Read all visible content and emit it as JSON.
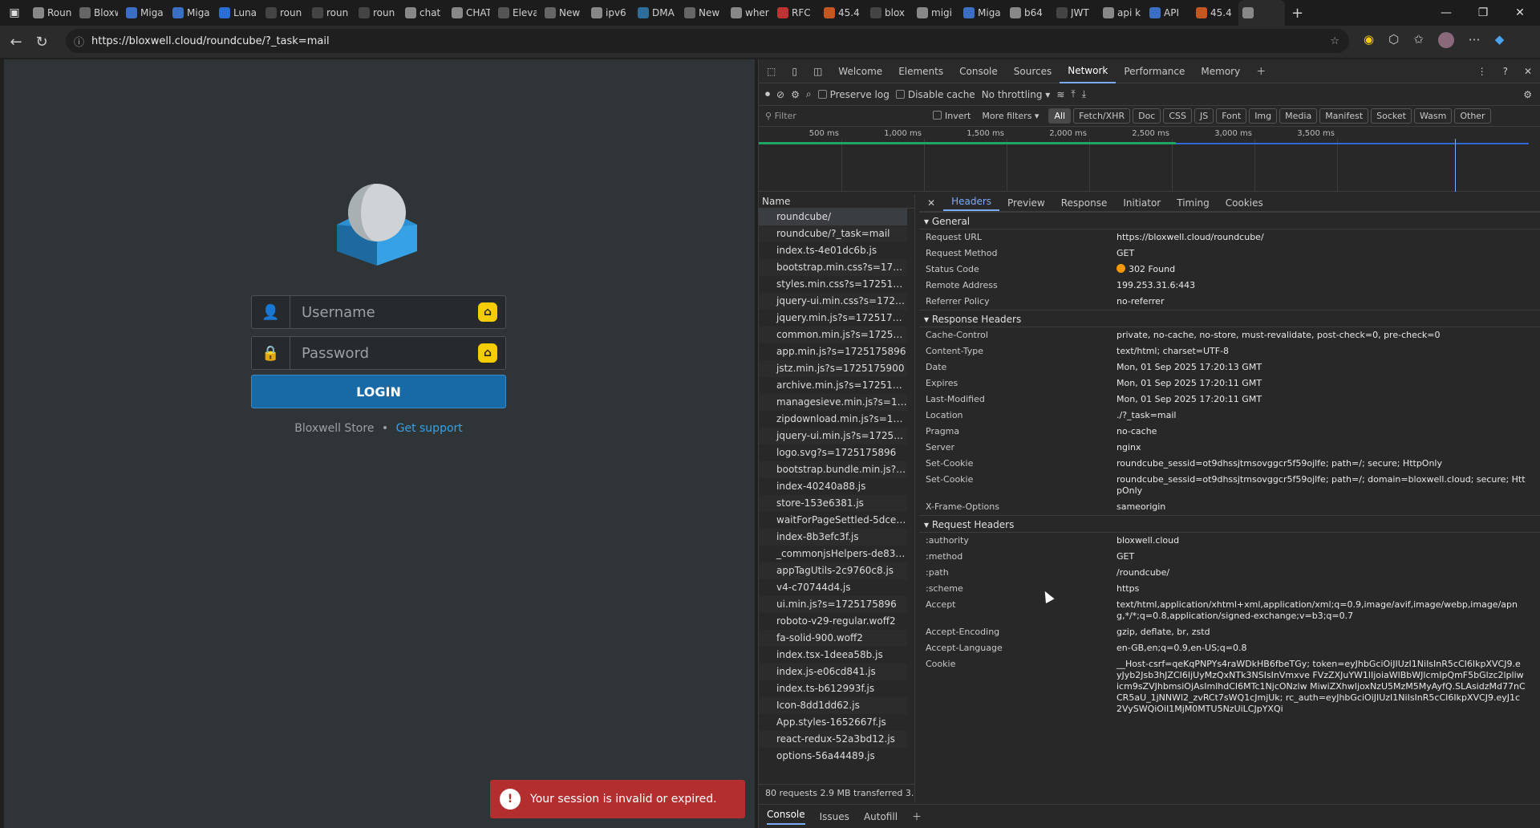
{
  "browser": {
    "tabs": [
      {
        "label": "Roun",
        "color": "#888888"
      },
      {
        "label": "Bloxw",
        "color": "#666666"
      },
      {
        "label": "Miga",
        "color": "#3b6fc4"
      },
      {
        "label": "Miga",
        "color": "#3b6fc4"
      },
      {
        "label": "Luna",
        "color": "#2a6fd6"
      },
      {
        "label": "roun",
        "color": "#444444"
      },
      {
        "label": "roun",
        "color": "#444444"
      },
      {
        "label": "roun",
        "color": "#444444"
      },
      {
        "label": "chat",
        "color": "#888888"
      },
      {
        "label": "CHAT",
        "color": "#888888"
      },
      {
        "label": "Eleva",
        "color": "#555555"
      },
      {
        "label": "New",
        "color": "#666666"
      },
      {
        "label": "ipv6",
        "color": "#888888"
      },
      {
        "label": "DMA",
        "color": "#2c6e99"
      },
      {
        "label": "New",
        "color": "#666666"
      },
      {
        "label": "wher",
        "color": "#888888"
      },
      {
        "label": "RFC",
        "color": "#b33"
      },
      {
        "label": "45.4",
        "color": "#c4561f"
      },
      {
        "label": "blox",
        "color": "#444444"
      },
      {
        "label": "migi",
        "color": "#888888"
      },
      {
        "label": "Miga",
        "color": "#3b6fc4"
      },
      {
        "label": "b64",
        "color": "#888888"
      },
      {
        "label": "JWT",
        "color": "#444444"
      },
      {
        "label": "api k",
        "color": "#888888"
      },
      {
        "label": "API",
        "color": "#3b6fc4"
      },
      {
        "label": "45.4",
        "color": "#c4561f"
      },
      {
        "label": "",
        "color": "#888888"
      }
    ],
    "url": "https://bloxwell.cloud/roundcube/?_task=mail"
  },
  "page": {
    "username_placeholder": "Username",
    "password_placeholder": "Password",
    "login_label": "LOGIN",
    "footer_store": "Bloxwell Store",
    "footer_sep": "•",
    "footer_support": "Get support",
    "toast": "Your session is invalid or expired."
  },
  "devtools": {
    "tabs": [
      "Welcome",
      "Elements",
      "Console",
      "Sources",
      "Network",
      "Performance",
      "Memory"
    ],
    "toolbar": {
      "preserve": "Preserve log",
      "disable": "Disable cache",
      "throttle": "No throttling"
    },
    "filter": {
      "placeholder": "Filter",
      "invert": "Invert",
      "more": "More filters",
      "chips": [
        "All",
        "Fetch/XHR",
        "Doc",
        "CSS",
        "JS",
        "Font",
        "Img",
        "Media",
        "Manifest",
        "Socket",
        "Wasm",
        "Other"
      ]
    },
    "timeline_ticks": [
      "500 ms",
      "1,000 ms",
      "1,500 ms",
      "2,000 ms",
      "2,500 ms",
      "3,000 ms",
      "3,500 ms"
    ],
    "name_header": "Name",
    "requests": [
      "roundcube/",
      "roundcube/?_task=mail",
      "index.ts-4e01dc6b.js",
      "bootstrap.min.css?s=17251...",
      "styles.min.css?s=1725175896",
      "jquery-ui.min.css?s=172517...",
      "jquery.min.js?s=1725175899",
      "common.min.js?s=1725175...",
      "app.min.js?s=1725175896",
      "jstz.min.js?s=1725175900",
      "archive.min.js?s=1725175896",
      "managesieve.min.js?s=1725...",
      "zipdownload.min.js?s=1725...",
      "jquery-ui.min.js?s=1725175...",
      "logo.svg?s=1725175896",
      "bootstrap.bundle.min.js?s=...",
      "index-40240a88.js",
      "store-153e6381.js",
      "waitForPageSettled-5dce85...",
      "index-8b3efc3f.js",
      "_commonjsHelpers-de833af...",
      "appTagUtils-2c9760c8.js",
      "v4-c70744d4.js",
      "ui.min.js?s=1725175896",
      "roboto-v29-regular.woff2",
      "fa-solid-900.woff2",
      "index.tsx-1deea58b.js",
      "index.js-e06cd841.js",
      "index.ts-b612993f.js",
      "Icon-8dd1dd62.js",
      "App.styles-1652667f.js",
      "react-redux-52a3bd12.js",
      "options-56a44489.js"
    ],
    "status": "80 requests   2.9 MB transferred   3.",
    "detail_tabs": [
      "Headers",
      "Preview",
      "Response",
      "Initiator",
      "Timing",
      "Cookies"
    ],
    "general_title": "General",
    "general": [
      {
        "k": "Request URL",
        "v": "https://bloxwell.cloud/roundcube/"
      },
      {
        "k": "Request Method",
        "v": "GET"
      },
      {
        "k": "Status Code",
        "v": "302 Found"
      },
      {
        "k": "Remote Address",
        "v": "199.253.31.6:443"
      },
      {
        "k": "Referrer Policy",
        "v": "no-referrer"
      }
    ],
    "response_title": "Response Headers",
    "response": [
      {
        "k": "Cache-Control",
        "v": "private, no-cache, no-store, must-revalidate, post-check=0, pre-check=0"
      },
      {
        "k": "Content-Type",
        "v": "text/html; charset=UTF-8"
      },
      {
        "k": "Date",
        "v": "Mon, 01 Sep 2025 17:20:13 GMT"
      },
      {
        "k": "Expires",
        "v": "Mon, 01 Sep 2025 17:20:11 GMT"
      },
      {
        "k": "Last-Modified",
        "v": "Mon, 01 Sep 2025 17:20:11 GMT"
      },
      {
        "k": "Location",
        "v": "./?_task=mail"
      },
      {
        "k": "Pragma",
        "v": "no-cache"
      },
      {
        "k": "Server",
        "v": "nginx"
      },
      {
        "k": "Set-Cookie",
        "v": "roundcube_sessid=ot9dhssjtmsovggcr5f59ojlfe; path=/; secure; HttpOnly"
      },
      {
        "k": "Set-Cookie",
        "v": "roundcube_sessid=ot9dhssjtmsovggcr5f59ojlfe; path=/; domain=bloxwell.cloud; secure; HttpOnly"
      },
      {
        "k": "X-Frame-Options",
        "v": "sameorigin"
      }
    ],
    "request_title": "Request Headers",
    "request": [
      {
        "k": ":authority",
        "v": "bloxwell.cloud"
      },
      {
        "k": ":method",
        "v": "GET"
      },
      {
        "k": ":path",
        "v": "/roundcube/"
      },
      {
        "k": ":scheme",
        "v": "https"
      },
      {
        "k": "Accept",
        "v": "text/html,application/xhtml+xml,application/xml;q=0.9,image/avif,image/webp,image/apng,*/*;q=0.8,application/signed-exchange;v=b3;q=0.7"
      },
      {
        "k": "Accept-Encoding",
        "v": "gzip, deflate, br, zstd"
      },
      {
        "k": "Accept-Language",
        "v": "en-GB,en;q=0.9,en-US;q=0.8"
      },
      {
        "k": "Cookie",
        "v": "__Host-csrf=qeKqPNPYs4raWDkHB6fbeTGy; token=eyJhbGciOiJIUzI1NiIsInR5cCI6IkpXVCJ9.eyJyb2Jsb3hJZCI6IjUyMzQxNTk3NSIsInVmxve FVzZXJuYW1lIjoiaWlBbWJlcmIpQmF5bGlzc2lpliwicm9sZVJhbmsiOjAsImlhdCI6MTc1NjcONzlw MiwiZXhwIjoxNzU5MzM5MyAyfQ.SLAsidzMd77nCCR5aU_1jNNWl2_zvRCt7sWQ1cJmjUk; rc_auth=eyJhbGciOiJIUzI1NiIsInR5cCI6IkpXVCJ9.eyJ1c2VySWQiOiI1MjM0MTU5NzUiLCJpYXQi"
      }
    ],
    "drawer": [
      "Console",
      "Issues",
      "Autofill"
    ]
  }
}
